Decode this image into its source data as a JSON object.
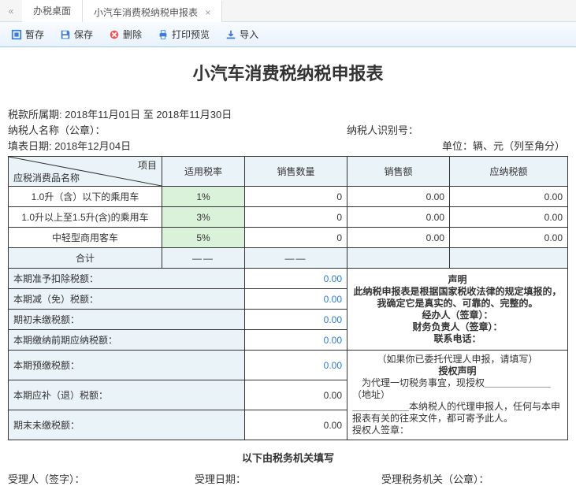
{
  "tabs": {
    "collapse": "«",
    "desktop": "办税桌面",
    "current": "小汽车消费税纳税申报表",
    "close": "×"
  },
  "toolbar": {
    "stash": "暂存",
    "save": "保存",
    "delete": "删除",
    "print": "打印预览",
    "import": "导入"
  },
  "title": "小汽车消费税纳税申报表",
  "info": {
    "period_label": "税款所属期:",
    "period_value": "2018年11月01日 至 2018年11月30日",
    "payer_name_label": "纳税人名称（公章）：",
    "payer_id_label": "纳税人识别号：",
    "fill_date_label": "填表日期:",
    "fill_date_value": "2018年12月04日",
    "unit": "单位：辆、元（列至角分）"
  },
  "headers": {
    "diag_top": "项目",
    "diag_bottom": "应税消费品名称",
    "rate": "适用税率",
    "qty": "销售数量",
    "amount": "销售额",
    "tax": "应纳税额"
  },
  "rows": [
    {
      "name": "1.0升（含）以下的乘用车",
      "rate": "1%",
      "qty": "0",
      "amount": "0.00",
      "tax": "0.00"
    },
    {
      "name": "1.0升以上至1.5升(含)的乘用车",
      "rate": "3%",
      "qty": "0",
      "amount": "0.00",
      "tax": "0.00"
    },
    {
      "name": "中轻型商用客车",
      "rate": "5%",
      "qty": "0",
      "amount": "0.00",
      "tax": "0.00"
    }
  ],
  "total_label": "合计",
  "dash": "——",
  "leftRows": {
    "r1": "本期准予扣除税额：",
    "r2": "本期减（免）税额：",
    "r3": "期初未缴税额：",
    "r4": "本期缴纳前期应纳税额：",
    "r5": "本期预缴税额：",
    "r6": "本期应补（退）税额：",
    "r7": "期末未缴税额："
  },
  "leftVals": {
    "v1": "0.00",
    "v2": "0.00",
    "v3": "0.00",
    "v4": "0.00",
    "v5": "0.00",
    "v6": "0.00",
    "v7": "0.00"
  },
  "decl1": {
    "title": "声明",
    "line1": "此纳税申报表是根据国家税收法律的规定填报的，我确定它是真实的、可靠的、完整的。",
    "line2": "经办人（签章）：",
    "line3": "财务负责人（签章）：",
    "line4": "联系电话："
  },
  "decl2": {
    "line1": "（如果你已委托代理人申报，请填写）",
    "title": "授权声明",
    "line2a": "为代理一切税务事宜，现授权＿＿＿＿＿＿＿（地址）",
    "line2b": "＿＿＿＿＿＿本纳税人的代理申报人，任何与本申报表有关的往来文件，都可寄予此人。",
    "line3": "授权人签章："
  },
  "footer": {
    "section": "以下由税务机关填写",
    "accepter": "受理人（签字）：",
    "acc_date": "受理日期：",
    "acc_org": "受理税务机关（公章）："
  }
}
